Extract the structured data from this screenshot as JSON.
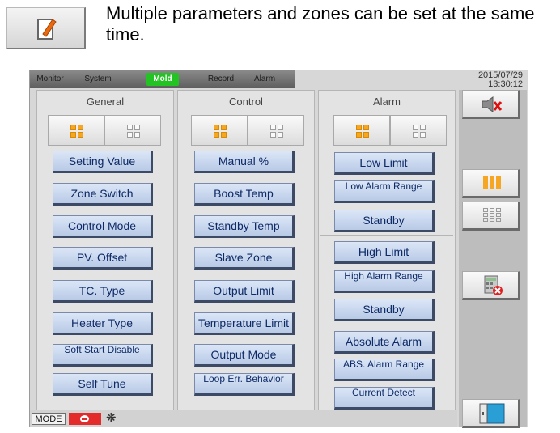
{
  "note": {
    "text": "Multiple parameters and zones can be set at the same time."
  },
  "tabs": [
    "Monitor",
    "System",
    "Mold",
    "Record",
    "Alarm"
  ],
  "active_tab": "Mold",
  "clock": {
    "date": "2015/07/29",
    "time": "13:30:12"
  },
  "columns": {
    "general": {
      "title": "General",
      "buttons": [
        "Setting Value",
        "Zone Switch",
        "Control Mode",
        "PV. Offset",
        "TC. Type",
        "Heater Type",
        "Soft Start Disable",
        "Self Tune"
      ]
    },
    "control": {
      "title": "Control",
      "buttons": [
        "Manual %",
        "Boost Temp",
        "Standby Temp",
        "Slave Zone",
        "Output Limit",
        "Temperature Limit",
        "Output Mode",
        "Loop Err. Behavior"
      ]
    },
    "alarm": {
      "title": "Alarm",
      "buttons": [
        "Low Limit",
        "Low Alarm Range",
        "Standby",
        "High Limit",
        "High Alarm Range",
        "Standby",
        "Absolute Alarm",
        "ABS. Alarm Range",
        "Current Detect"
      ]
    }
  },
  "status": {
    "mode_label": "MODE"
  },
  "colors": {
    "active_tab": "#22c322",
    "button_face": "#c8d6ee",
    "button_text": "#0d2a66",
    "selected_grid": "#f5a623",
    "stop": "#e32b2b"
  },
  "icons": [
    "edit-note-icon",
    "mute-speaker-icon",
    "select-all-zones-icon",
    "deselect-zones-icon",
    "calculator-cancel-icon",
    "exit-door-icon",
    "stop-icon",
    "fan-icon"
  ]
}
